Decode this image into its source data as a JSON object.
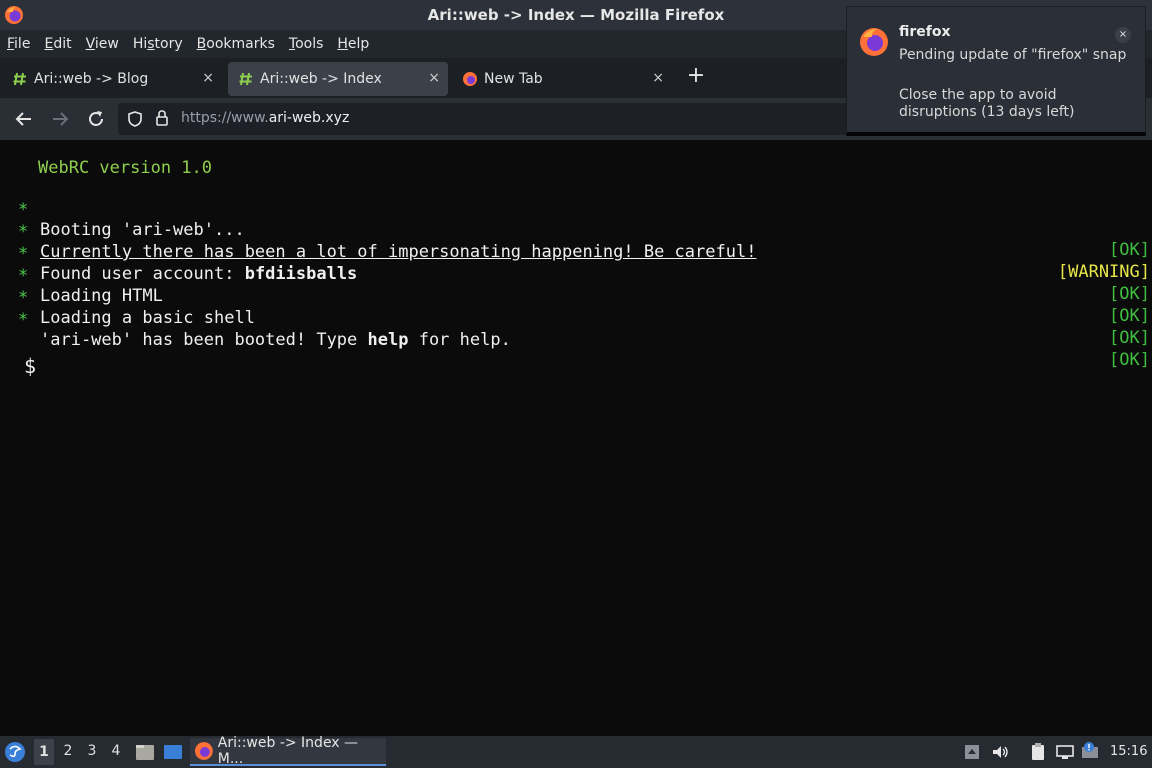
{
  "window": {
    "title": "Ari::web -> Index — Mozilla Firefox"
  },
  "menubar": [
    {
      "label": "File",
      "accel": "F",
      "rest": "ile"
    },
    {
      "label": "Edit",
      "accel": "E",
      "rest": "dit"
    },
    {
      "label": "View",
      "accel": "V",
      "rest": "iew"
    },
    {
      "label": "History",
      "pre": "Hi",
      "accel": "s",
      "rest": "tory"
    },
    {
      "label": "Bookmarks",
      "accel": "B",
      "rest": "ookmarks"
    },
    {
      "label": "Tools",
      "accel": "T",
      "rest": "ools"
    },
    {
      "label": "Help",
      "accel": "H",
      "rest": "elp"
    }
  ],
  "tabs": [
    {
      "label": "Ari::web -> Blog",
      "icon": "hash-icon",
      "active": false
    },
    {
      "label": "Ari::web -> Index",
      "icon": "hash-icon",
      "active": true
    },
    {
      "label": "New Tab",
      "icon": "firefox-icon",
      "active": false
    }
  ],
  "tab_close_glyph": "×",
  "new_tab_glyph": "+",
  "navbar": {
    "url_prefix": "https://www.",
    "url_domain": "ari-web.xyz"
  },
  "terminal": {
    "version": "WebRC version 1.0",
    "bullet": "*",
    "lines": [
      {
        "text": "Booting 'ari-web'...",
        "status": "[OK]"
      },
      {
        "text": "Currently there has been a lot of impersonating happening! Be careful!",
        "status": "[WARNING]"
      },
      {
        "text_pre": "Found user account: ",
        "text_bold": "bfdiisballs",
        "text_post": "",
        "status": "[OK]"
      },
      {
        "text": "Loading HTML",
        "status": "[OK]"
      },
      {
        "text": "Loading a basic shell",
        "status": "[OK]"
      },
      {
        "text_pre": "'ari-web' has been booted! Type ",
        "text_bold": "help",
        "text_post": " for help.",
        "status": "[OK]"
      }
    ],
    "prompt": "$"
  },
  "notification": {
    "title": "firefox",
    "body1": "Pending update of \"firefox\" snap",
    "body2": "Close the app to avoid disruptions (13 days left)",
    "close_glyph": "×"
  },
  "taskbar": {
    "workspaces": [
      "1",
      "2",
      "3",
      "4"
    ],
    "active_workspace": "1",
    "task_label": "Ari::web -> Index — M...",
    "clock": "15:16"
  },
  "colors": {
    "ok": "#3fbf3f",
    "warning": "#e6e64a",
    "version": "#8fcf4f",
    "accent": "#5a8fd8"
  }
}
